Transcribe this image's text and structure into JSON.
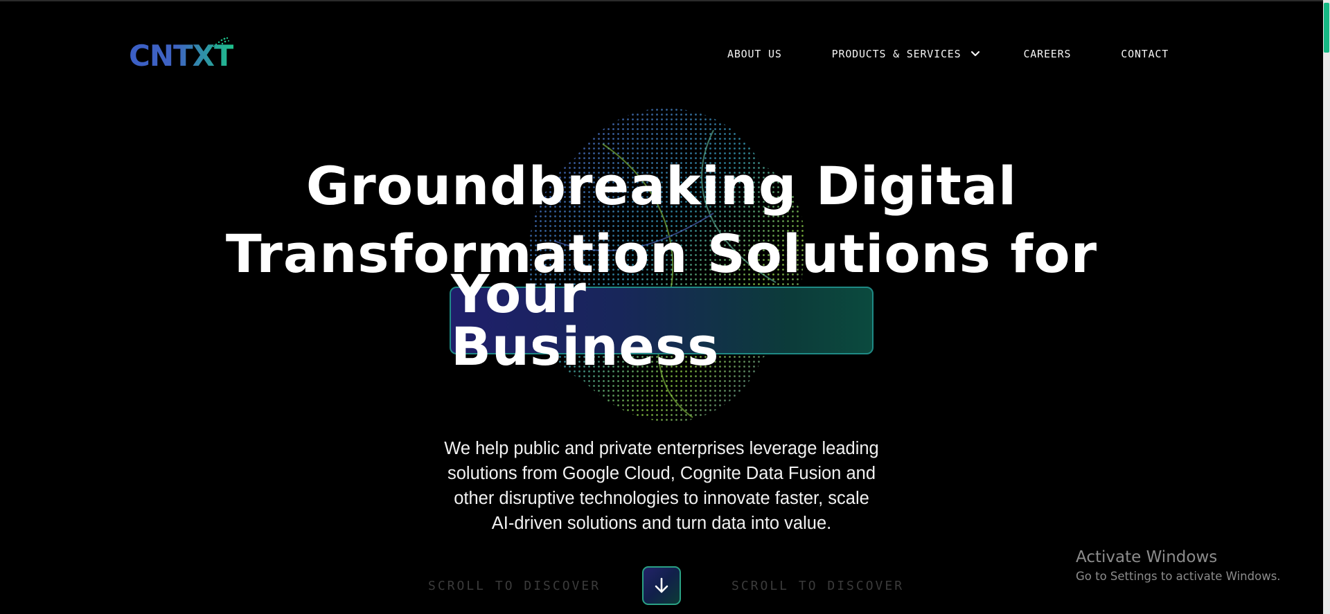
{
  "brand": {
    "name": "CNTXT",
    "accent_colors": [
      "#3b5fc6",
      "#1ec08a"
    ]
  },
  "nav": {
    "items": [
      {
        "label": "ABOUT US"
      },
      {
        "label": "PRODUCTS & SERVICES",
        "icon": "chevron-down-icon"
      },
      {
        "label": "CAREERS"
      },
      {
        "label": "CONTACT"
      }
    ]
  },
  "hero": {
    "title_line_1": "Groundbreaking Digital",
    "title_line_2": "Transformation Solutions for",
    "title_highlight": "Your Business",
    "subtitle_lines": [
      "We help public and private enterprises leverage leading",
      "solutions from Google Cloud, Cognite Data Fusion and",
      "other disruptive technologies to innovate faster, scale",
      "AI-driven solutions and turn data into value."
    ]
  },
  "scroll": {
    "left_label": "SCROLL TO DISCOVER",
    "right_label": "SCROLL TO DISCOVER",
    "button_icon": "arrow-down-icon"
  },
  "watermark": {
    "title": "Activate Windows",
    "subtitle": "Go to Settings to activate Windows."
  }
}
